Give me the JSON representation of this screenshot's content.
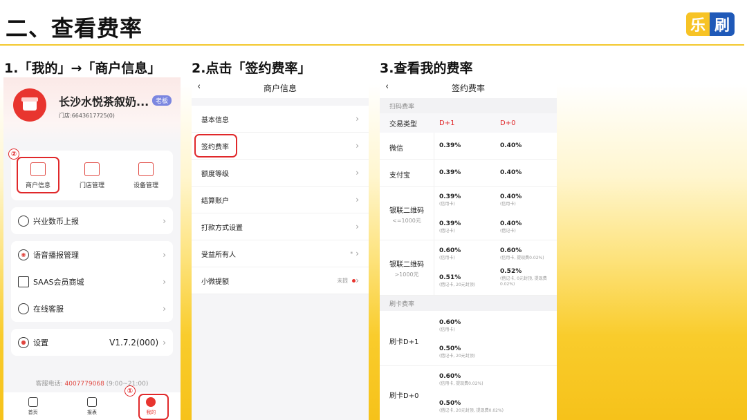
{
  "slide": {
    "title": "二、查看费率",
    "logo_left": "乐",
    "logo_right": "刷",
    "step1": "1.「我的」→「商户信息」",
    "step2": "2.点击「签约费率」",
    "step3": "3.查看我的费率"
  },
  "mine": {
    "shop_name": "长沙水悦茶叙奶...",
    "role_badge": "老板",
    "shop_id": "门店:6643617725(0)",
    "grid": [
      "商户信息",
      "门店管理",
      "设备管理"
    ],
    "row_xingye": "兴业数币上报",
    "row_voice": "语音播报管理",
    "row_saas": "SAAS会员商城",
    "row_service": "在线客服",
    "row_settings": "设置",
    "version": "V1.7.2(000)",
    "hotline_prefix": "客服电话: ",
    "hotline_number": "4007779068",
    "hotline_hours": " (9:00~21:00)",
    "tabs": [
      "首页",
      "报表",
      "我的"
    ],
    "marker1": "①",
    "marker2": "②"
  },
  "merchant": {
    "nav_title": "商户信息",
    "back": "‹",
    "items": [
      {
        "label": "基本信息",
        "right": ""
      },
      {
        "label": "签约费率",
        "right": ""
      },
      {
        "label": "额度等级",
        "right": ""
      },
      {
        "label": "结算账户",
        "right": ""
      },
      {
        "label": "打款方式设置",
        "right": ""
      },
      {
        "label": "受益所有人",
        "right": "*"
      },
      {
        "label": "小微提额",
        "right": "未提"
      }
    ]
  },
  "rates": {
    "nav_title": "签约费率",
    "back": "‹",
    "section_scan": "扫码费率",
    "header": {
      "type": "交易类型",
      "d1": "D+1",
      "d0": "D+0"
    },
    "wechat": {
      "label": "微信",
      "d1": "0.39%",
      "d0": "0.40%"
    },
    "alipay": {
      "label": "支付宝",
      "d1": "0.39%",
      "d0": "0.40%"
    },
    "union_low": {
      "label": "银联二维码",
      "sub": "<=1000元",
      "credit_d1": "0.39%",
      "credit_d1_note": "(信用卡)",
      "credit_d0": "0.40%",
      "credit_d0_note": "(信用卡)",
      "debit_d1": "0.39%",
      "debit_d1_note": "(借记卡)",
      "debit_d0": "0.40%",
      "debit_d0_note": "(借记卡)"
    },
    "union_high": {
      "label": "银联二维码",
      "sub": ">1000元",
      "credit_d1": "0.60%",
      "credit_d1_note": "(信用卡)",
      "credit_d0": "0.60%",
      "credit_d0_note": "(信用卡, 提现费0.02%)",
      "debit_d1": "0.51%",
      "debit_d1_note": "(借记卡, 20元封顶)",
      "debit_d0": "0.52%",
      "debit_d0_note": "(借记卡, 0元封顶, 提现费0.02%)"
    },
    "section_card": "刷卡费率",
    "card_d1": {
      "label": "刷卡D+1",
      "credit": "0.60%",
      "credit_note": "(信用卡)",
      "debit": "0.50%",
      "debit_note": "(借记卡, 20元封顶)"
    },
    "card_d0": {
      "label": "刷卡D+0",
      "credit": "0.60%",
      "credit_note": "(信用卡, 提现费0.02%)",
      "debit": "0.50%",
      "debit_note": "(借记卡, 20元封顶, 提现费0.02%)"
    }
  }
}
